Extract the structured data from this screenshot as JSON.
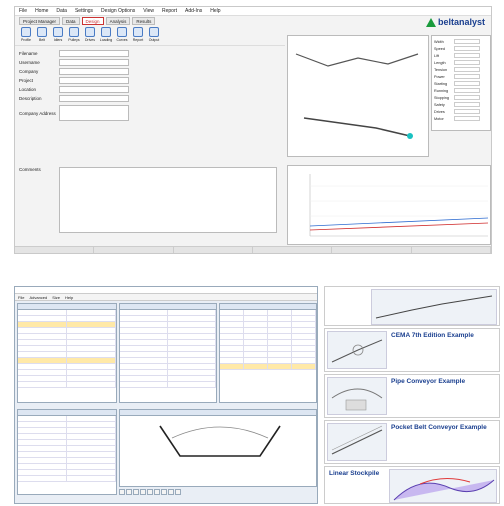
{
  "win1": {
    "brand": "beltanalyst",
    "menu": [
      "File",
      "Home",
      "Data",
      "Settings",
      "Design Options",
      "View",
      "Report",
      "Add-Ins",
      "Help"
    ],
    "tabs": [
      {
        "label": "Project Manager"
      },
      {
        "label": "Data"
      },
      {
        "label": "Design",
        "active": true
      },
      {
        "label": "Analysis"
      },
      {
        "label": "Results"
      }
    ],
    "toolbar": [
      "Profile",
      "Belt",
      "Idlers",
      "Pulleys",
      "Drives",
      "Loading",
      "Curves",
      "Report",
      "Output"
    ],
    "form": [
      {
        "key": "Filename",
        "value": ""
      },
      {
        "key": "Username",
        "value": ""
      },
      {
        "key": "Company",
        "value": ""
      },
      {
        "key": "Project",
        "value": ""
      },
      {
        "key": "Location",
        "value": ""
      },
      {
        "key": "Description",
        "value": ""
      },
      {
        "key": "Company Address",
        "value": "",
        "big": true
      }
    ],
    "comments_label": "Comments",
    "side": [
      {
        "key": "Width",
        "value": ""
      },
      {
        "key": "Speed",
        "value": ""
      },
      {
        "key": "Lift",
        "value": ""
      },
      {
        "key": "Length",
        "value": ""
      },
      {
        "key": "Tension",
        "value": ""
      },
      {
        "key": "Power",
        "value": ""
      },
      {
        "key": "Starting",
        "value": ""
      },
      {
        "key": "Running",
        "value": ""
      },
      {
        "key": "Stopping",
        "value": ""
      },
      {
        "key": "Safety",
        "value": ""
      },
      {
        "key": "Drives",
        "value": ""
      },
      {
        "key": "Motor",
        "value": ""
      }
    ],
    "chart_label": "",
    "status": [
      "",
      "",
      "",
      "",
      "",
      ""
    ]
  },
  "win2": {
    "title": "",
    "menu": [
      "File",
      "Advanced",
      "Size",
      "Help"
    ],
    "panels": {
      "material": "",
      "belt": "",
      "idler": "",
      "motor": "",
      "cross": ""
    },
    "tabs_bottom": [
      "",
      "",
      "",
      "",
      "",
      "",
      "",
      "",
      ""
    ]
  },
  "cards": [
    {
      "title": "",
      "text": ""
    },
    {
      "title": "CEMA 7th Edition Example",
      "text": ""
    },
    {
      "title": "Pipe Conveyor Example",
      "text": ""
    },
    {
      "title": "Pocket Belt Conveyor Example",
      "text": ""
    },
    {
      "title": "Linear Stockpile",
      "text": ""
    }
  ],
  "cema5": {
    "title": ""
  },
  "colors": {
    "accent": "#1a3f8f",
    "brand_green": "#1a9b3c",
    "highlight": "#ffe9a8"
  }
}
